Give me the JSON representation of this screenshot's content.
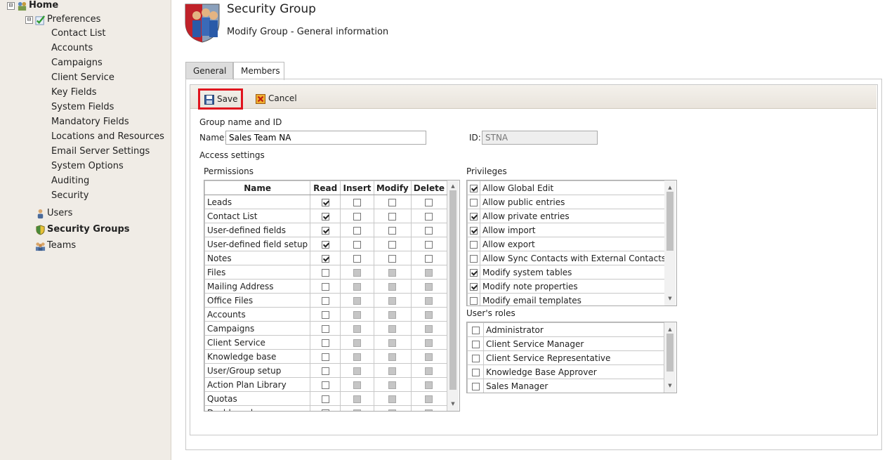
{
  "sidebar": {
    "home": "Home",
    "preferences": "Preferences",
    "pref_items": [
      "Contact List",
      "Accounts",
      "Campaigns",
      "Client Service",
      "Key Fields",
      "System Fields",
      "Mandatory Fields",
      "Locations and Resources",
      "Email Server Settings",
      "System Options",
      "Auditing",
      "Security"
    ],
    "users": "Users",
    "security_groups": "Security Groups",
    "teams": "Teams",
    "expander_minus": "⊟"
  },
  "header": {
    "title": "Security Group",
    "subtitle": "Modify Group - General information"
  },
  "tabs": [
    {
      "label": "General"
    },
    {
      "label": "Members"
    }
  ],
  "toolbar": {
    "save_label": "Save",
    "cancel_label": "Cancel"
  },
  "form": {
    "group_name_heading": "Group name and ID",
    "name_label": "Name:",
    "name_value": "Sales Team NA",
    "id_label": "ID:",
    "id_value": "STNA",
    "access_heading": "Access settings",
    "permissions_heading": "Permissions",
    "privileges_heading": "Privileges",
    "roles_heading": "User's roles"
  },
  "permissions": {
    "columns": [
      "Name",
      "Read",
      "Insert",
      "Modify",
      "Delete"
    ],
    "rows": [
      {
        "name": "Leads",
        "read": true,
        "enabled": true
      },
      {
        "name": "Contact List",
        "read": true,
        "enabled": true
      },
      {
        "name": "User-defined fields",
        "read": true,
        "enabled": true
      },
      {
        "name": "User-defined field setup",
        "read": true,
        "enabled": true
      },
      {
        "name": "Notes",
        "read": true,
        "enabled": true
      },
      {
        "name": "Files",
        "read": false,
        "enabled": false
      },
      {
        "name": "Mailing Address",
        "read": false,
        "enabled": false
      },
      {
        "name": "Office Files",
        "read": false,
        "enabled": false
      },
      {
        "name": "Accounts",
        "read": false,
        "enabled": false
      },
      {
        "name": "Campaigns",
        "read": false,
        "enabled": false
      },
      {
        "name": "Client Service",
        "read": false,
        "enabled": false
      },
      {
        "name": "Knowledge base",
        "read": false,
        "enabled": false
      },
      {
        "name": "User/Group setup",
        "read": false,
        "enabled": false
      },
      {
        "name": "Action Plan Library",
        "read": false,
        "enabled": false
      },
      {
        "name": "Quotas",
        "read": false,
        "enabled": false
      },
      {
        "name": "Dashboards",
        "read": false,
        "enabled": false
      }
    ]
  },
  "privileges": [
    {
      "label": "Allow Global Edit",
      "checked": true
    },
    {
      "label": "Allow public entries",
      "checked": false
    },
    {
      "label": "Allow private entries",
      "checked": true
    },
    {
      "label": "Allow import",
      "checked": true
    },
    {
      "label": "Allow export",
      "checked": false
    },
    {
      "label": "Allow Sync Contacts with External Contacts",
      "checked": false
    },
    {
      "label": "Modify system tables",
      "checked": true
    },
    {
      "label": "Modify note properties",
      "checked": true
    },
    {
      "label": "Modify email templates",
      "checked": false
    }
  ],
  "roles": [
    {
      "label": "Administrator",
      "checked": false
    },
    {
      "label": "Client Service Manager",
      "checked": false
    },
    {
      "label": "Client Service Representative",
      "checked": false
    },
    {
      "label": "Knowledge Base Approver",
      "checked": false
    },
    {
      "label": "Sales Manager",
      "checked": false
    }
  ],
  "colors": {
    "highlight": "#e0141e"
  }
}
